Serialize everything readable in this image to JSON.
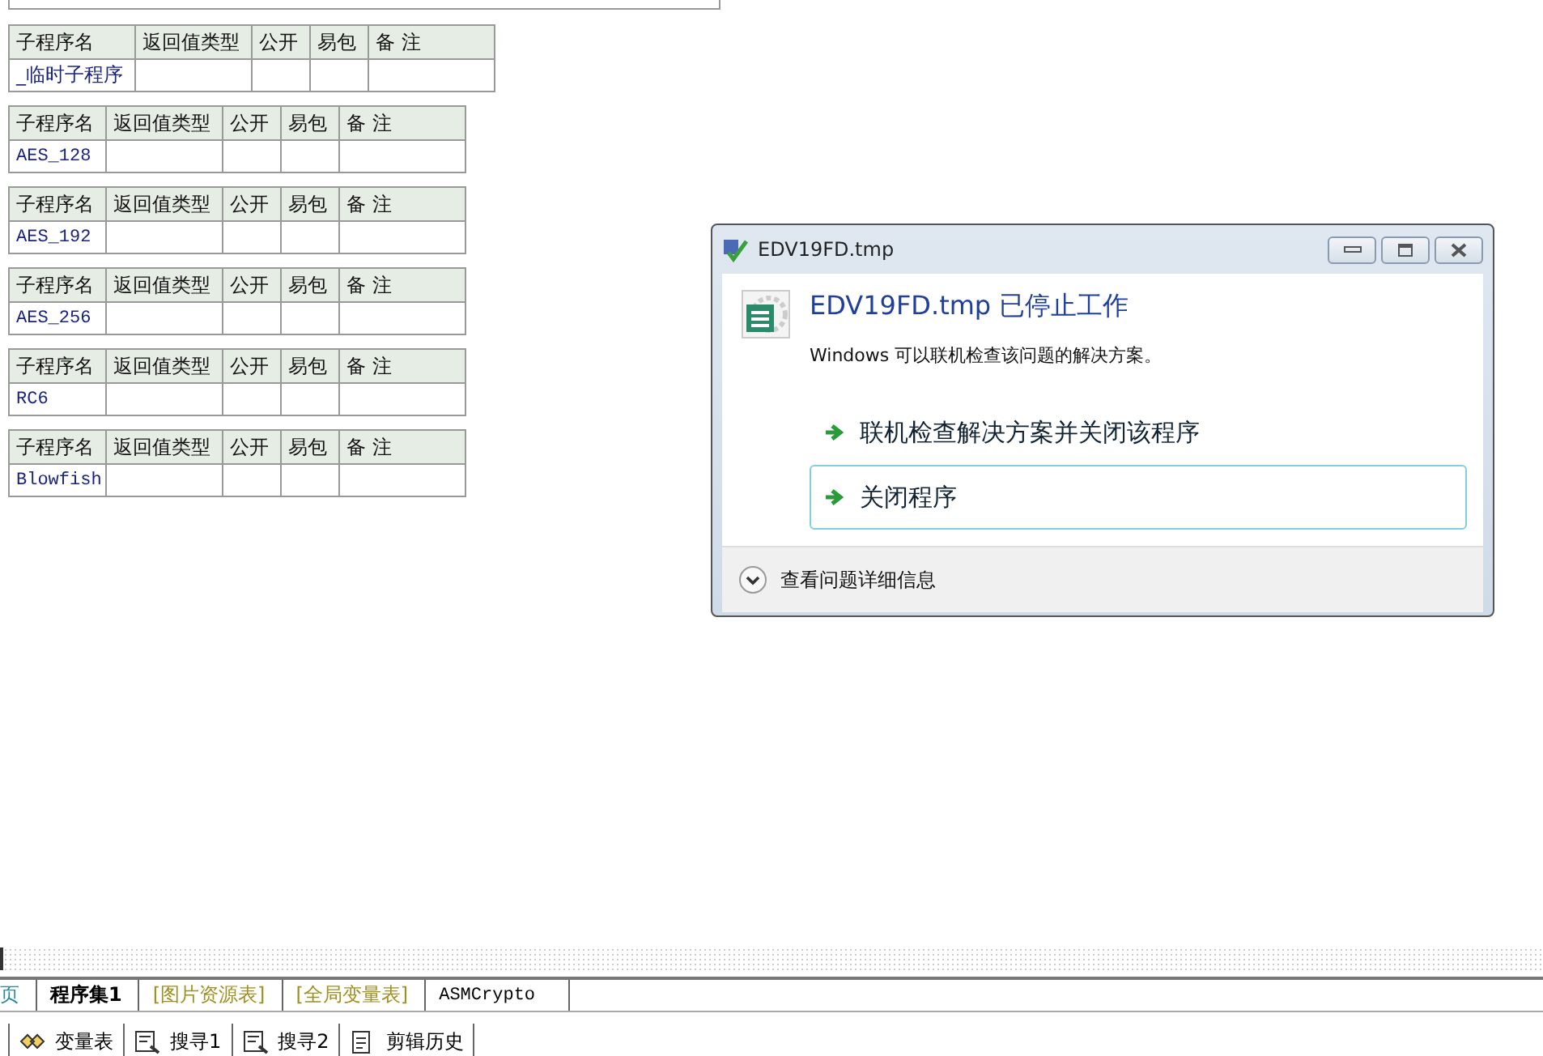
{
  "tables": [
    {
      "columns": [
        "子程序名",
        "返回值类型",
        "公开",
        "易包",
        "备 注"
      ],
      "rows": [
        [
          "_临时子程序",
          "",
          "",
          "",
          ""
        ]
      ],
      "wide": true
    },
    {
      "columns": [
        "子程序名",
        "返回值类型",
        "公开",
        "易包",
        "备 注"
      ],
      "rows": [
        [
          "AES_128",
          "",
          "",
          "",
          ""
        ]
      ],
      "wide": false
    },
    {
      "columns": [
        "子程序名",
        "返回值类型",
        "公开",
        "易包",
        "备 注"
      ],
      "rows": [
        [
          "AES_192",
          "",
          "",
          "",
          ""
        ]
      ],
      "wide": false
    },
    {
      "columns": [
        "子程序名",
        "返回值类型",
        "公开",
        "易包",
        "备 注"
      ],
      "rows": [
        [
          "AES_256",
          "",
          "",
          "",
          ""
        ]
      ],
      "wide": false
    },
    {
      "columns": [
        "子程序名",
        "返回值类型",
        "公开",
        "易包",
        "备 注"
      ],
      "rows": [
        [
          "RC6",
          "",
          "",
          "",
          ""
        ]
      ],
      "wide": false
    },
    {
      "columns": [
        "子程序名",
        "返回值类型",
        "公开",
        "易包",
        "备 注"
      ],
      "rows": [
        [
          "Blowfish",
          "",
          "",
          "",
          ""
        ]
      ],
      "wide": false
    }
  ],
  "dialog": {
    "title": "EDV19FD.tmp",
    "heading": "EDV19FD.tmp 已停止工作",
    "message": "Windows 可以联机检查该问题的解决方案。",
    "options": [
      {
        "label": "联机检查解决方案并关闭该程序",
        "selected": false
      },
      {
        "label": "关闭程序",
        "selected": true
      }
    ],
    "details": "查看问题详细信息"
  },
  "tabs": [
    {
      "label": "页",
      "selected": false,
      "color": "#2a8a9a"
    },
    {
      "label": "程序集1",
      "selected": true,
      "color": "#000000"
    },
    {
      "label": "[图片资源表]",
      "selected": false,
      "color": "#a09020"
    },
    {
      "label": "[全局变量表]",
      "selected": false,
      "color": "#a09020"
    },
    {
      "label": "ASMCrypto",
      "selected": false,
      "color": "#000000"
    }
  ],
  "toolbar": [
    {
      "label": "变量表",
      "kind": "variables"
    },
    {
      "label": "搜寻1",
      "kind": "search"
    },
    {
      "label": "搜寻2",
      "kind": "search"
    },
    {
      "label": "剪辑历史",
      "kind": "clipboard"
    }
  ]
}
